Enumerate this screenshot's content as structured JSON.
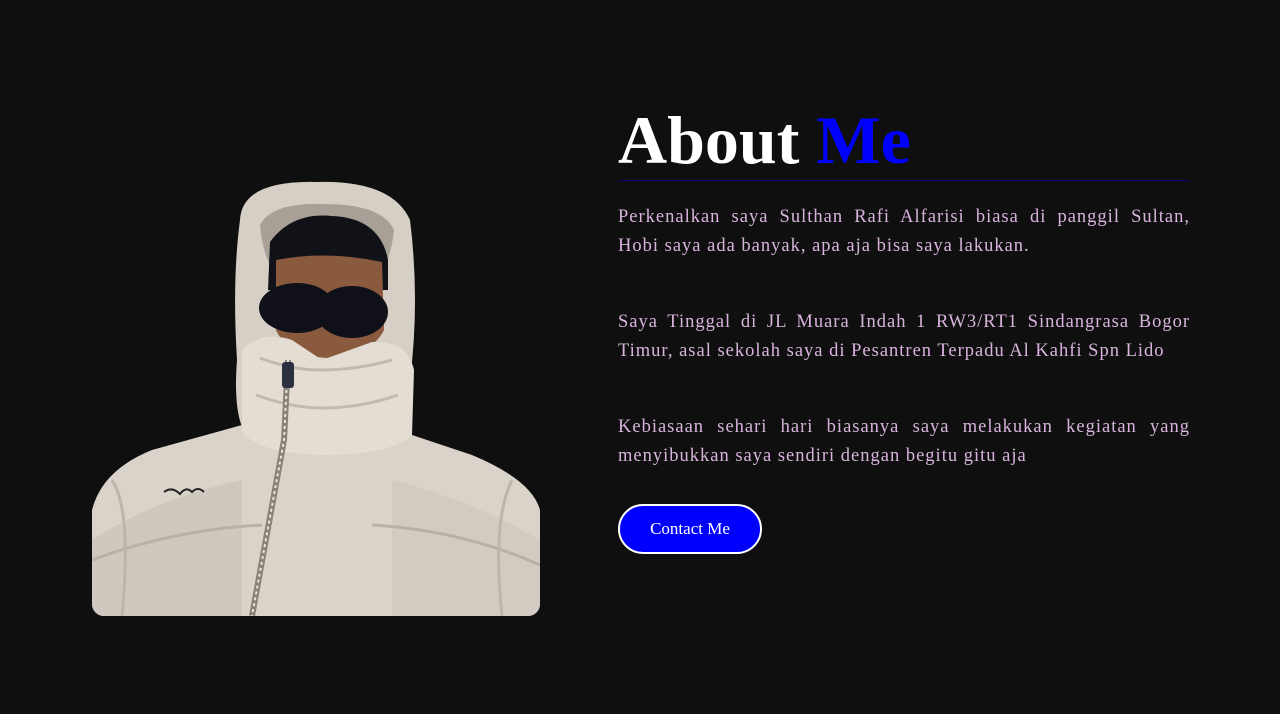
{
  "about": {
    "title_main": "About",
    "title_accent": "Me",
    "paragraphs": [
      "Perkenalkan saya Sulthan Rafi Alfarisi biasa di panggil Sultan, Hobi saya ada banyak, apa aja bisa saya lakukan.",
      "Saya Tinggal di JL Muara Indah 1 RW3/RT1 Sindangrasa Bogor Timur, asal sekolah saya di Pesantren Terpadu Al Kahfi Spn Lido",
      "Kebiasaan sehari hari biasanya saya melakukan kegiatan yang menyibukkan saya sendiri dengan begitu gitu aja"
    ],
    "contact_button": "Contact Me"
  },
  "colors": {
    "background": "#0f0f0f",
    "accent": "#0000ff",
    "paragraph_text": "#d8b4dd",
    "button_border": "#ffffff"
  }
}
